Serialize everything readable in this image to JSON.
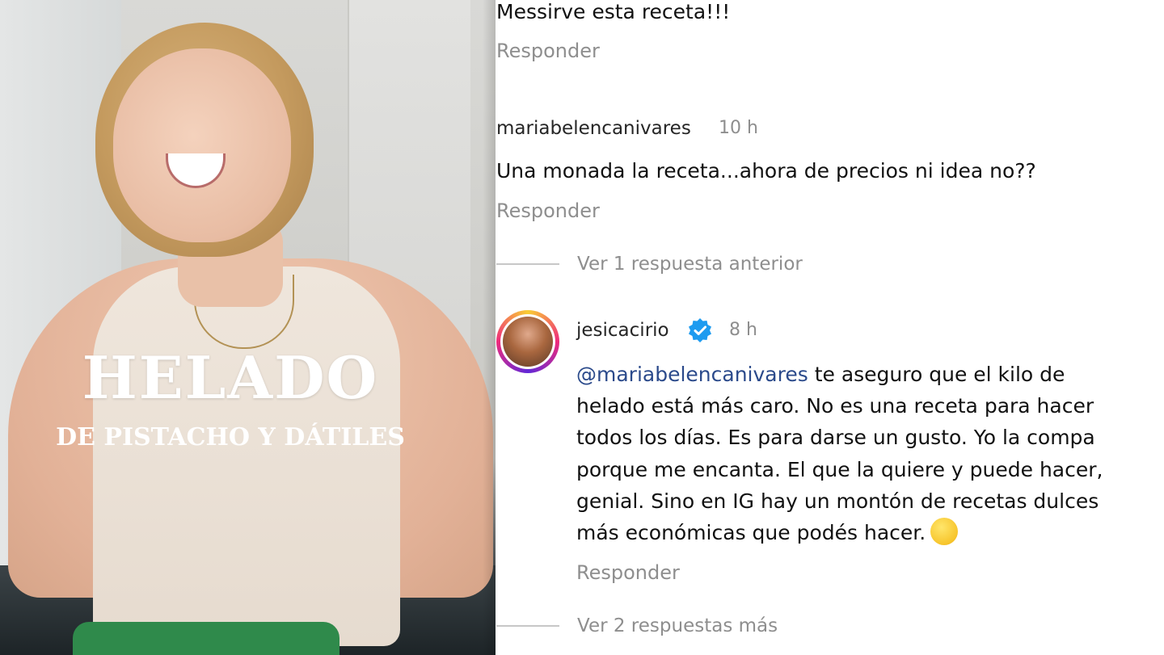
{
  "photo": {
    "title_main": "HELADO",
    "title_sub": "DE PISTACHO Y DÁTILES"
  },
  "comments": {
    "top_comment_text": "Messirve esta receta!!!",
    "top_comment_reply": "Responder",
    "comment2": {
      "username": "mariabelencanivares",
      "time": "10 h",
      "text": "Una monada la receta...ahora de precios ni idea no??",
      "reply": "Responder"
    },
    "view_previous": "Ver 1 respuesta anterior",
    "reply_comment": {
      "username": "jesicacirio",
      "verified": true,
      "time": "8 h",
      "mention": "@mariabelencanivares",
      "line1": " te aseguro que el kilo de",
      "line2": "helado está más caro. No es una receta para hacer",
      "line3": "todos los días. Es para darse un gusto. Yo la compa",
      "line4": "porque me encanta. El que la quiere y puede hacer,",
      "line5": "genial. Sino en IG hay un montón de recetas dulces",
      "line6": "más económicas que podés hacer.",
      "emoji": "wink-emoji",
      "reply": "Responder"
    },
    "view_more": "Ver 2 respuestas más"
  },
  "colors": {
    "mention": "#2b4a8b",
    "muted": "#8e8e8e",
    "verified": "#1d9bf0"
  }
}
